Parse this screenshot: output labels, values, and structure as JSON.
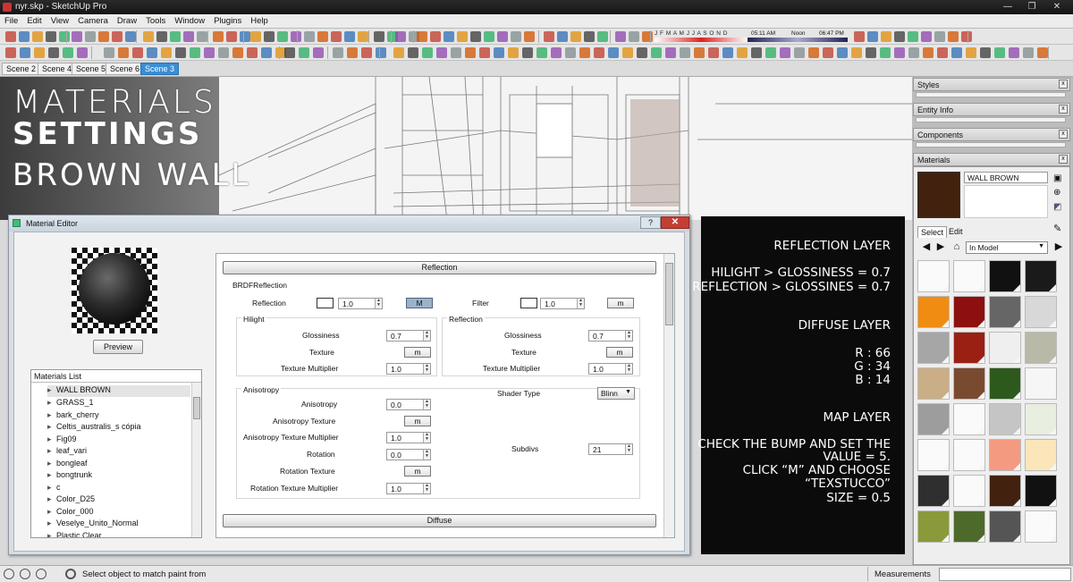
{
  "window": {
    "title": "nyr.skp - SketchUp Pro",
    "buttons": [
      "—",
      "❐",
      "✕"
    ]
  },
  "menu": [
    "File",
    "Edit",
    "View",
    "Camera",
    "Draw",
    "Tools",
    "Window",
    "Plugins",
    "Help"
  ],
  "shadow_toolbar": {
    "months": "J F M A M J J A S O N D",
    "time_start": "05:11 AM",
    "noon": "Noon",
    "time_end": "06:47 PM"
  },
  "scenes": [
    {
      "label": "Scene 2",
      "active": false
    },
    {
      "label": "Scene 4",
      "active": false
    },
    {
      "label": "Scene 5",
      "active": false
    },
    {
      "label": "Scene 6",
      "active": false
    },
    {
      "label": "Scene 3",
      "active": true
    }
  ],
  "overlay": {
    "line1": "MATERIALS",
    "line2": "SETTINGS",
    "line3": "BROWN WALL"
  },
  "info_panel": {
    "reflection_title": "REFLECTION LAYER",
    "reflection_line1": "HILIGHT > GLOSSINESS = 0.7",
    "reflection_line2": "REFLECTION > GLOSSINES = 0.7",
    "diffuse_title": "DIFFUSE LAYER",
    "r": "R : 66",
    "g": "G : 34",
    "b": "B : 14",
    "map_title": "MAP LAYER",
    "map_line1": "CHECK THE BUMP AND SET THE",
    "map_line2": "VALUE = 5.",
    "map_line3": "CLICK “M” AND CHOOSE",
    "map_line4": "“TEXSTUCCO”",
    "map_line5": "SIZE = 0.5"
  },
  "material_editor": {
    "title": "Material Editor",
    "help": "?",
    "close": "✕",
    "preview_label": "Preview",
    "materials_list_label": "Materials List",
    "materials": [
      "WALL BROWN",
      "GRASS_1",
      "bark_cherry",
      "Celtis_australis_s cópia",
      "Fig09",
      "leaf_vari",
      "bongleaf",
      "bongtrunk",
      "c",
      "Color_D25",
      "Color_000",
      "Veselye_Unito_Normal",
      "Plastic Clear"
    ],
    "reflection_rollout": "Reflection",
    "brdf_group": "BRDFReflection",
    "reflection_label": "Reflection",
    "reflection_value": "1.0",
    "m_button": "M",
    "filter_label": "Filter",
    "filter_value": "1.0",
    "m_small": "m",
    "hilight_group": "Hilight",
    "glossiness_label": "Glossiness",
    "hilight_glossiness": "0.7",
    "texture_label": "Texture",
    "texture_multiplier_label": "Texture Multiplier",
    "hilight_tex_mult": "1.0",
    "reflection_group": "Reflection",
    "refl_glossiness": "0.7",
    "refl_tex_mult": "1.0",
    "anisotropy_group": "Anisotropy",
    "anisotropy_label": "Anisotropy",
    "anisotropy_value": "0.0",
    "anisotropy_texture_label": "Anisotropy Texture",
    "anisotropy_tex_mult_label": "Anisotropy Texture Multiplier",
    "anisotropy_tex_mult": "1.0",
    "rotation_label": "Rotation",
    "rotation_value": "0.0",
    "rotation_texture_label": "Rotation Texture",
    "rotation_tex_mult_label": "Rotation Texture Multiplier",
    "rotation_tex_mult": "1.0",
    "shader_type_label": "Shader Type",
    "shader_type_value": "Blinn",
    "subdivs_label": "Subdivs",
    "subdivs_value": "21",
    "diffuse_rollout": "Diffuse"
  },
  "tray": {
    "styles": "Styles",
    "entity_info": "Entity Info",
    "components": "Components",
    "materials": "Materials",
    "close": "x",
    "material_name": "WALL BROWN",
    "select_tab": "Select",
    "edit_tab": "Edit",
    "collection": "In Model"
  },
  "status": {
    "message": "Select object to match paint from",
    "measurements_label": "Measurements"
  },
  "colors": {
    "accent": "#3a8ed6",
    "close_red": "#c43f32",
    "wall_brown": "#42220e"
  }
}
